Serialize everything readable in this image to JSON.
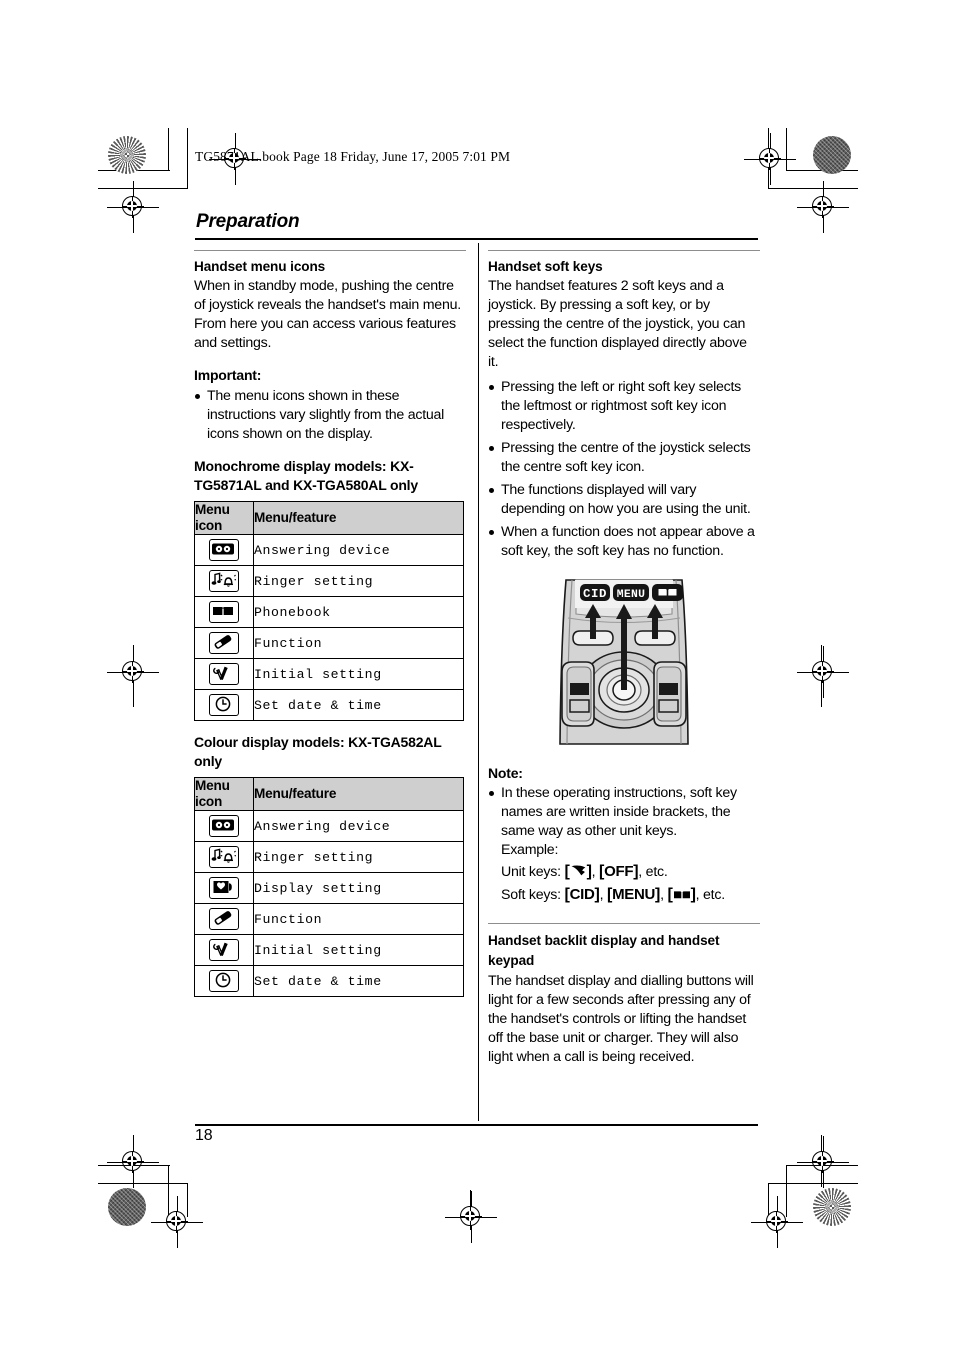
{
  "book_header": "TG5871AL.book  Page 18  Friday, June 17, 2005  7:01 PM",
  "chapter_title": "Preparation",
  "page_number": "18",
  "left_column": {
    "section1": {
      "heading": "Handset menu icons",
      "body": "When in standby mode, pushing the centre of joystick reveals the handset's main menu. From here you can access various features and settings.",
      "important_label": "Important:",
      "important_bullets": [
        "The menu icons shown in these instructions vary slightly from the actual icons shown on the display."
      ],
      "table1_caption": "Monochrome display models: KX-TG5871AL and KX-TGA580AL only",
      "table_headers": [
        "Menu icon",
        "Menu/feature"
      ],
      "table1_rows": [
        {
          "icon": "answering-device-icon",
          "feature": "Answering device"
        },
        {
          "icon": "ringer-setting-icon",
          "feature": "Ringer setting"
        },
        {
          "icon": "phonebook-icon",
          "feature": "Phonebook"
        },
        {
          "icon": "function-icon",
          "feature": "Function"
        },
        {
          "icon": "initial-setting-icon",
          "feature": "Initial setting"
        },
        {
          "icon": "set-date-time-icon",
          "feature": "Set date & time"
        }
      ],
      "table2_caption": "Colour display models: KX-TGA582AL only",
      "table2_rows": [
        {
          "icon": "answering-device-icon",
          "feature": "Answering device"
        },
        {
          "icon": "ringer-setting-icon",
          "feature": "Ringer setting"
        },
        {
          "icon": "display-setting-icon",
          "feature": "Display setting"
        },
        {
          "icon": "function-icon",
          "feature": "Function"
        },
        {
          "icon": "initial-setting-icon",
          "feature": "Initial setting"
        },
        {
          "icon": "set-date-time-icon",
          "feature": "Set date & time"
        }
      ]
    }
  },
  "right_column": {
    "softkeys": {
      "heading": "Handset soft keys",
      "body": "The handset features 2 soft keys and a joystick. By pressing a soft key, or by pressing the centre of the joystick, you can select the function displayed directly above it.",
      "bullets": [
        "Pressing the left or right soft key selects the leftmost or rightmost soft key icon respectively.",
        "Pressing the centre of the joystick selects the centre soft key icon.",
        "The functions displayed will vary depending on how you are using the unit.",
        "When a function does not appear above a soft key, the soft key has no function."
      ]
    },
    "figure": {
      "name": "handset-softkey-diagram",
      "display_labels": [
        "CID",
        "MENU",
        "phonebook-glyph"
      ]
    },
    "note": {
      "heading": "Note:",
      "bullet": "In these operating instructions, soft key names are written inside brackets, the same way as other unit keys.",
      "example_label": "Example:",
      "unit_keys_label": "Unit keys:",
      "unit_keys": [
        "talk-handset-glyph",
        "OFF"
      ],
      "unit_keys_suffix": ", etc.",
      "soft_keys_label": "Soft keys:",
      "soft_keys": [
        "CID",
        "MENU",
        "phonebook-glyph"
      ],
      "soft_keys_suffix": ", etc."
    },
    "backlit": {
      "heading": "Handset backlit display and handset keypad",
      "body": "The handset display and dialling buttons will light for a few seconds after pressing any of the handset's controls or lifting the handset off the base unit or charger. They will also light when a call is being received."
    }
  },
  "colors": {
    "table_header_bg": "#cfcfcf",
    "rule": "#000000",
    "section_rule": "#8d8d8d"
  }
}
